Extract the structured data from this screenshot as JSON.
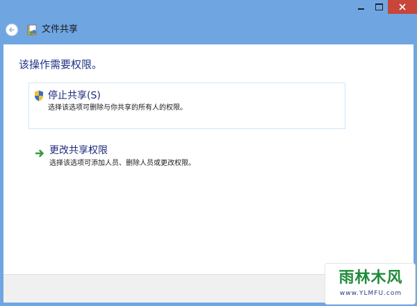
{
  "window": {
    "title": "文件共享",
    "controls": {
      "minimize": "minimize",
      "maximize": "maximize",
      "close": "close"
    },
    "accent_close": "#c7453a",
    "frame_color": "#6fa6e2"
  },
  "content": {
    "heading": "该操作需要权限。",
    "options": [
      {
        "title": "停止共享(S)",
        "description": "选择该选项可删除与你共享的所有人的权限。",
        "icon": "uac-shield-icon"
      },
      {
        "title": "更改共享权限",
        "description": "选择该选项可添加人员、删除人员或更改权限。",
        "icon": "green-arrow-icon"
      }
    ]
  },
  "watermark": {
    "main": "雨林木风",
    "url": "www.YLMFU.com"
  }
}
